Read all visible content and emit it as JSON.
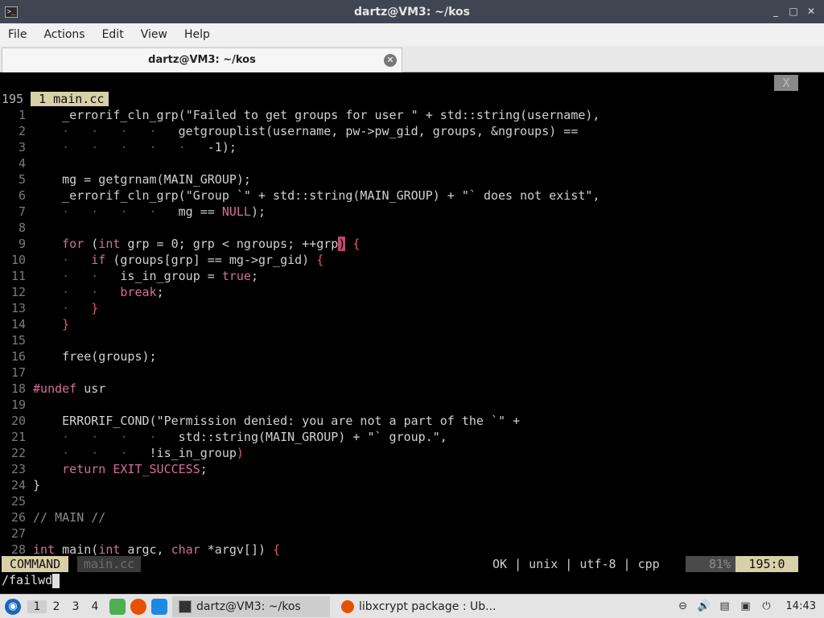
{
  "window": {
    "title": "dartz@VM3: ~/kos",
    "app_icon": ">_",
    "controls": [
      "_",
      "□",
      "✕"
    ]
  },
  "menubar": [
    "File",
    "Actions",
    "Edit",
    "View",
    "Help"
  ],
  "tab": {
    "label": "dartz@VM3: ~/kos",
    "close_icon": "✕"
  },
  "vim": {
    "tabline": "1 main.cc",
    "close": "X",
    "count": "195",
    "status": {
      "mode": "COMMAND",
      "file": "main.cc",
      "info": "OK | unix | utf-8 | cpp",
      "percent": "81%",
      "position": "195:0"
    },
    "cmdline": "/failwd"
  },
  "taskbar": {
    "workspaces": [
      "1",
      "2",
      "3",
      "4"
    ],
    "tasks": [
      {
        "label": "dartz@VM3: ~/kos",
        "active": true
      },
      {
        "label": "libxcrypt package : Ub...",
        "active": false
      }
    ],
    "clock": "14:43"
  },
  "colors": {
    "titlebar": "#404552",
    "vim_accent": "#d7d0a8",
    "keyword": "#d26f9a"
  }
}
